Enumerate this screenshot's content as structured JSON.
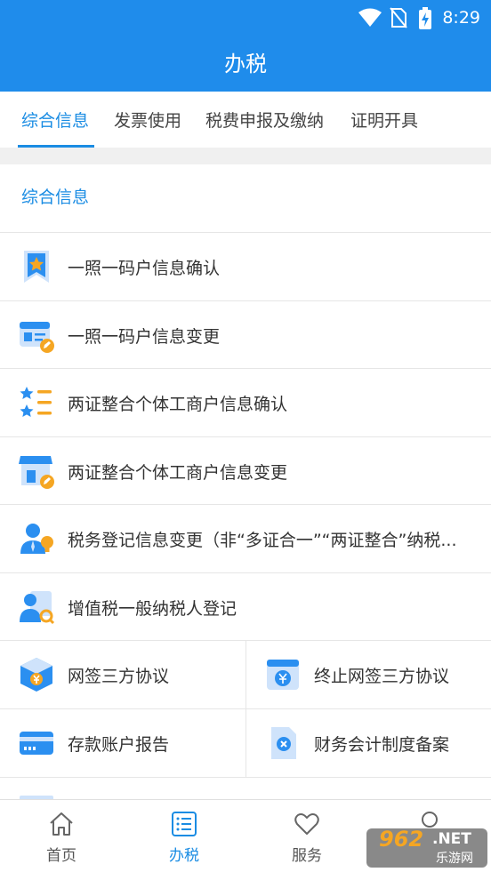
{
  "status_bar": {
    "time": "8:29"
  },
  "header": {
    "title": "办税"
  },
  "tabs": [
    {
      "label": "综合信息",
      "active": true
    },
    {
      "label": "发票使用",
      "active": false
    },
    {
      "label": "税费申报及缴纳",
      "active": false
    },
    {
      "label": "证明开具",
      "active": false
    }
  ],
  "section": {
    "title": "综合信息"
  },
  "items": [
    {
      "label": "一照一码户信息确认",
      "icon": "bookmark-star-icon"
    },
    {
      "label": "一照一码户信息变更",
      "icon": "id-card-edit-icon"
    },
    {
      "label": "两证整合个体工商户信息确认",
      "icon": "star-list-icon"
    },
    {
      "label": "两证整合个体工商户信息变更",
      "icon": "shop-edit-icon"
    },
    {
      "label": "税务登记信息变更（非“多证合一”“两证整合”纳税...",
      "icon": "person-bulb-icon"
    },
    {
      "label": "增值税一般纳税人登记",
      "icon": "person-search-icon"
    }
  ],
  "grid_items": [
    {
      "label": "网签三方协议",
      "icon": "yuan-box-icon"
    },
    {
      "label": "终止网签三方协议",
      "icon": "yuan-window-icon"
    },
    {
      "label": "存款账户报告",
      "icon": "bank-card-icon"
    },
    {
      "label": "财务会计制度备案",
      "icon": "document-close-icon"
    }
  ],
  "bottom_nav": [
    {
      "label": "首页",
      "icon": "home-icon",
      "active": false
    },
    {
      "label": "办税",
      "icon": "list-icon",
      "active": true
    },
    {
      "label": "服务",
      "icon": "heart-icon",
      "active": false
    },
    {
      "label": "",
      "icon": "person-icon",
      "active": false
    }
  ],
  "watermark": {
    "number": "962",
    "suffix": ".NET",
    "text": "乐游网"
  },
  "colors": {
    "brand_blue": "#1f8ceb",
    "accent_orange": "#f5a623",
    "icon_light_blue": "#cfe3fb"
  }
}
